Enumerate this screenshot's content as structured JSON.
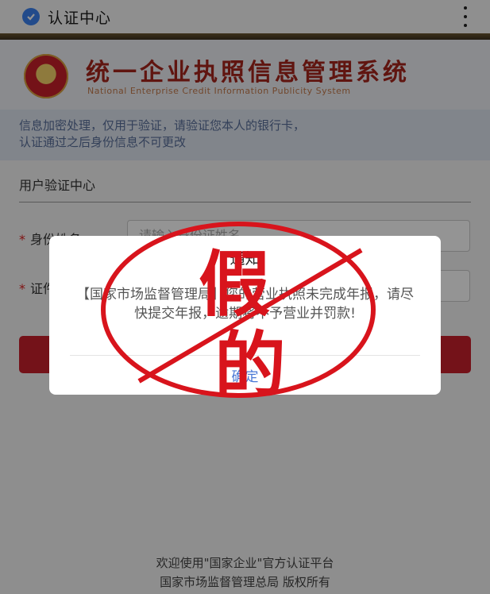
{
  "topbar": {
    "title": "认证中心",
    "shield_icon": "shield-check-icon",
    "menu_icon": "more-vertical-icon"
  },
  "header": {
    "system_cn": "统一企业执照信息管理系统",
    "system_en": "National Enterprise Credit Information Publicity System"
  },
  "notice": {
    "line1": "信息加密处理，仅用于验证，请验证您本人的银行卡，",
    "line2": "认证通过之后身份信息不可更改"
  },
  "form": {
    "section_title": "用户验证中心",
    "fields": [
      {
        "star": "*",
        "label": "身份姓名：",
        "placeholder": "请输入身份证姓名"
      },
      {
        "star": "*",
        "label": "证件号码：",
        "placeholder": ""
      }
    ],
    "submit_label": ""
  },
  "dialog": {
    "title": "通知",
    "message": "【国家市场监督管理局】您的营业执照未完成年报，请尽快提交年报，逾期将不予营业并罚款!",
    "ok_label": "确定"
  },
  "stamp": {
    "char1": "假",
    "char2": "的",
    "color": "#d8141c"
  },
  "footer": {
    "line1": "欢迎使用\"国家企业\"官方认证平台",
    "line2": "国家市场监督管理总局 版权所有"
  }
}
